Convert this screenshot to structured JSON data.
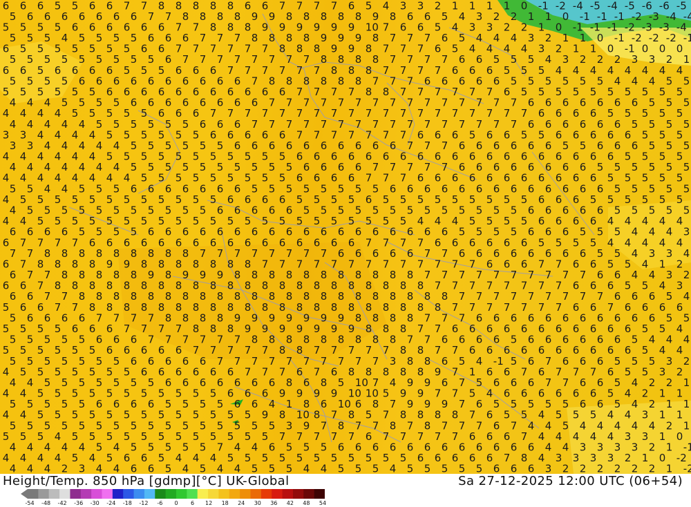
{
  "header": {
    "left_title": "Height/Temp. 850 hPa [gdmp][°C] UK-Global",
    "right_title": "Sa 27-12-2025 12:00 UTC (06+54)"
  },
  "colorbar": {
    "ticks": [
      "-54",
      "-48",
      "-42",
      "-36",
      "-30",
      "-24",
      "-18",
      "-12",
      "-6",
      "0",
      "6",
      "12",
      "18",
      "24",
      "30",
      "36",
      "42",
      "48",
      "54"
    ],
    "colors": [
      "#7a7a7a",
      "#9a9a9a",
      "#bcbcbc",
      "#dedede",
      "#8f2d8f",
      "#b43cb4",
      "#d84fd8",
      "#f070f0",
      "#2020c8",
      "#2c57e6",
      "#3c8cf0",
      "#52b8f5",
      "#1a8a1a",
      "#22aa22",
      "#30c830",
      "#50e050",
      "#f8ee50",
      "#f6d838",
      "#f4c21c",
      "#f2a810",
      "#ee8e0a",
      "#ea6a08",
      "#e63a06",
      "#d81c10",
      "#b81010",
      "#920c0c",
      "#6a0808",
      "#3e0404"
    ]
  },
  "map": {
    "rows": [
      "6 6 6 5 5 6 6 7 7 8 8 8 8 8 6 6 7 7 7 7 6 5 4 3 3 2 1 1 1 1 0 -1 -2 -4 -5 -4 -5 -6 -6 -5",
      "5 6 6 6 6 6 6 6 7 7 8 8 8 8 9 9 8 8 8 8 8 9 8 6 6 5 4 3 2 2 1 1 0 -1 -1 -1 -2 -3 -4 -4",
      "5 5 5 5 6 6 6 6 6 6 7 7 8 8 8 9 9 9 9 9 9 10 7 6 6 5 4 3 3 2 2 1 0 -1 -1 -1 -2 -3 -3 -4",
      "5 5 5 4 5 5 5 5 6 6 6 7 7 7 8 8 8 8 9 9 9 8 7 7 7 6 5 4 4 4 3 2 1 1 0 -1 -2 -2 -2 -1",
      "6 5 5 5 5 5 5 5 6 6 7 7 7 7 7 7 8 8 8 9 9 8 7 7 7 6 5 4 4 4 4 3 2 1 1 0 -1 0 0 0",
      "5 5 5 5 5 5 5 5 5 6 7 7 7 7 7 7 7 7 8 8 8 8 7 7 7 7 6 6 5 5 5 4 3 2 2 2 3 3 2 1",
      "6 6 5 6 6 6 6 5 5 5 6 6 6 7 7 7 7 7 7 8 8 8 7 7 7 7 6 6 6 5 5 5 4 4 4 4 4 4 4 4",
      "5 5 5 5 6 6 6 6 6 6 6 6 6 6 7 8 8 8 8 8 8 7 7 7 6 6 6 6 6 5 5 5 5 5 5 4 4 4 5 5",
      "5 5 5 5 5 5 6 6 6 6 6 6 6 6 6 6 6 7 7 7 7 8 8 7 7 7 7 7 7 6 5 5 5 5 5 5 5 5 5 5",
      "4 4 4 5 5 5 5 6 6 6 6 6 6 6 6 7 7 7 7 7 7 7 7 7 7 7 7 7 7 7 6 6 6 6 6 6 6 5 5 5",
      "4 4 4 4 5 5 5 5 5 6 6 6 7 7 7 7 7 7 7 7 7 7 7 7 7 7 7 7 7 7 7 6 6 6 6 5 5 5 5 5",
      "4 4 4 4 4 5 5 5 5 5 5 6 6 6 7 7 7 7 7 7 7 7 7 7 7 7 7 7 7 7 6 6 6 6 6 6 5 5 5 5",
      "3 3 4 4 4 4 5 5 5 5 5 5 6 6 6 6 6 7 7 7 7 7 7 7 6 6 6 5 6 6 5 5 6 6 6 6 6 5 5 5",
      "3 3 4 4 4 4 4 5 5 5 5 5 5 6 6 6 6 6 6 6 6 6 6 7 7 7 6 6 6 6 6 6 5 5 6 6 6 5 5 5",
      "4 4 4 4 4 4 5 5 5 5 5 5 5 5 5 5 5 6 6 6 6 6 6 6 6 6 6 6 6 6 6 6 6 6 6 6 5 5 5 5",
      "4 4 4 4 4 4 4 5 5 5 5 5 5 5 5 5 5 6 6 6 6 7 7 7 7 7 6 6 6 6 6 6 6 6 5 5 5 5 5 5",
      "4 4 4 4 4 4 4 4 5 5 5 5 5 5 5 5 5 6 6 6 6 7 7 7 6 6 6 6 6 6 6 6 6 6 6 5 5 5 5 5",
      "5 5 4 4 5 5 5 6 6 6 6 6 6 6 5 5 5 5 5 5 5 5 6 6 6 6 6 6 6 6 6 6 6 6 6 5 5 5 5 5",
      "4 5 5 5 5 5 5 5 5 5 5 5 5 6 6 6 6 5 5 5 5 6 5 5 5 5 5 5 5 5 5 6 6 6 5 5 5 5 5 5",
      "4 5 5 5 5 5 5 5 5 5 5 5 6 6 6 6 6 5 5 5 5 5 5 5 5 5 5 5 5 5 6 6 6 6 6 5 5 5 5 5",
      "4 4 5 5 5 5 5 5 5 5 5 5 5 5 5 5 5 5 5 5 5 5 5 5 4 4 4 5 5 5 5 6 6 6 6 4 4 4 4 4",
      "6 6 6 6 5 5 5 5 6 6 6 6 6 6 6 6 6 6 6 6 6 6 6 6 6 6 5 5 5 5 6 6 6 5 5 5 4 4 4 3",
      "6 7 7 7 7 6 6 6 6 6 6 6 6 6 6 6 6 6 6 6 6 7 7 7 7 6 6 6 6 6 6 5 5 5 5 4 4 4 4 4",
      "7 7 8 8 8 8 8 8 8 8 8 7 7 7 7 7 7 7 7 6 6 6 6 6 7 7 6 6 6 6 6 6 6 6 5 5 4 3 3 4",
      "6 7 8 8 8 8 9 9 8 8 8 8 8 8 8 7 7 7 7 7 7 7 7 7 7 7 7 7 6 6 6 7 7 6 6 5 5 4 1 2",
      "6 7 7 8 8 8 8 8 9 8 9 9 9 8 8 8 8 8 8 8 8 8 8 8 7 7 7 7 7 7 7 7 7 7 6 6 4 4 3 2",
      "6 6 7 8 8 8 8 8 8 8 8 8 8 8 8 8 8 8 8 8 8 8 8 8 8 7 7 7 7 7 7 7 7 6 6 6 5 5 4 3",
      "6 6 7 7 8 8 8 8 8 8 8 8 8 8 8 8 8 8 8 8 8 8 8 8 8 8 7 7 7 7 7 7 7 7 7 6 6 6 5 4",
      "5 6 6 7 7 8 8 8 8 8 8 8 8 8 8 8 8 8 8 8 8 8 8 8 8 8 7 7 7 7 7 7 7 6 6 7 6 6 6 6",
      "5 6 6 6 6 7 7 7 7 8 8 8 8 9 9 9 9 9 9 9 8 8 8 8 7 7 7 6 6 6 6 6 6 6 6 6 6 6 5 5",
      "5 5 5 5 6 6 6 7 7 7 7 8 8 8 9 9 9 9 9 9 9 8 8 8 7 7 6 6 6 6 6 6 6 6 6 6 6 5 5 4",
      "5 5 5 5 5 6 6 6 7 7 7 7 7 7 8 8 8 8 8 8 8 8 8 7 7 6 6 6 6 5 6 6 6 6 6 6 5 4 4 4",
      "5 5 5 5 5 5 6 6 6 6 6 7 7 7 7 7 8 8 7 7 7 7 7 8 8 7 7 6 6 6 6 6 6 6 6 6 6 5 4 4",
      "5 5 5 5 5 5 5 6 6 6 6 6 7 7 7 7 7 7 7 7 7 7 3 8 8 6 5 4 -1 5 6 7 6 6 6 5 5 5 3 2",
      "4 5 5 5 5 5 5 5 6 6 6 6 6 6 7 7 7 6 7 6 8 8 8 8 8 9 7 1 6 6 7 6 7 7 7 6 5 5 3 2",
      "4 4 5 5 5 5 5 5 5 6 6 6 6 6 6 6 8 6 8 5 10 7 4 9 9 6 7 5 6 6 6 7 7 6 6 5 4 2 2 1",
      "4 4 5 5 5 5 5 5 5 5 5 5 5 6 6 6 9 9 9 9 10 10 5 9 9 7 7 5 4 6 6 6 6 6 6 5 4 2 1 1",
      "5 5 5 5 5 6 6 6 6 5 5 5 5 6 6 4 1 8 6 10 6 8 7 9 9 9 7 6 5 5 5 5 5 6 6 5 4 2 1 1",
      "4 4 5 5 5 5 5 5 5 5 5 5 5 5 5 9 8 10 8 7 8 5 7 8 8 8 8 7 6 5 5 4 5 5 5 4 4 3 1 1",
      "5 5 5 5 5 5 5 5 5 5 5 5 5 5 5 5 3 9 7 8 7 7 8 7 8 7 7 7 6 7 4 4 5 4 4 4 4 4 2 1",
      "5 5 5 4 5 5 5 5 5 5 5 5 5 5 5 5 7 7 7 7 7 6 7 7 7 7 7 6 6 6 7 4 4 4 4 4 3 3 1 0",
      "4 4 4 4 4 5 4 5 5 5 5 5 7 4 4 6 5 5 5 6 6 6 6 6 6 6 6 6 6 6 6 4 4 3 3 3 3 2 1 -1",
      "4 4 4 4 5 4 5 6 6 5 4 4 4 5 5 5 5 5 5 5 5 5 5 5 6 6 6 6 6 7 8 4 3 3 3 3 2 1 0 -2",
      "4 4 4 2 3 4 4 6 6 5 4 5 4 4 5 5 5 4 4 5 5 5 4 5 5 5 5 5 6 6 6 3 2 2 2 2 2 2 1 -2"
    ]
  }
}
